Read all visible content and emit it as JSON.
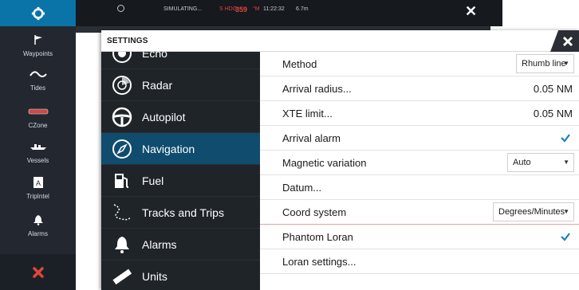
{
  "statusbar": {
    "text": "SIMULATING...",
    "heading_label": "S HDG",
    "heading_value": "359",
    "heading_unit": "°M",
    "time": "11:22:32",
    "distance": "6.7m"
  },
  "sidebar": {
    "items": [
      {
        "label": "Waypoints",
        "icon": "flag-icon"
      },
      {
        "label": "Tides",
        "icon": "wave-icon"
      },
      {
        "label": "CZone",
        "icon": "czone-icon"
      },
      {
        "label": "Vessels",
        "icon": "vessel-icon"
      },
      {
        "label": "TripIntel",
        "icon": "trip-icon"
      },
      {
        "label": "Alarms",
        "icon": "bell-icon"
      }
    ]
  },
  "dialog": {
    "title": "SETTINGS"
  },
  "categories": [
    {
      "label": "Echo",
      "icon": "echo-icon"
    },
    {
      "label": "Radar",
      "icon": "radar-icon"
    },
    {
      "label": "Autopilot",
      "icon": "steering-wheel-icon"
    },
    {
      "label": "Navigation",
      "icon": "compass-icon",
      "selected": true
    },
    {
      "label": "Fuel",
      "icon": "fuel-pump-icon"
    },
    {
      "label": "Tracks and Trips",
      "icon": "track-icon"
    },
    {
      "label": "Alarms",
      "icon": "bell-icon"
    },
    {
      "label": "Units",
      "icon": "ruler-icon"
    }
  ],
  "rows": {
    "method": {
      "label": "Method",
      "value": "Rhumb line"
    },
    "arrival_radius": {
      "label": "Arrival radius...",
      "value": "0.05 NM"
    },
    "xte_limit": {
      "label": "XTE limit...",
      "value": "0.05 NM"
    },
    "arrival_alarm": {
      "label": "Arrival alarm",
      "checked": true
    },
    "magnetic_variation": {
      "label": "Magnetic variation",
      "value": "Auto"
    },
    "datum": {
      "label": "Datum..."
    },
    "coord_system": {
      "label": "Coord system",
      "value": "Degrees/Minutes"
    },
    "phantom_loran": {
      "label": "Phantom Loran",
      "checked": true
    },
    "loran_settings": {
      "label": "Loran settings..."
    }
  },
  "colors": {
    "accent": "#0a73a8",
    "selected_category": "#0f4c6e",
    "check": "#1e7fc0",
    "heading": "#e0463a"
  }
}
